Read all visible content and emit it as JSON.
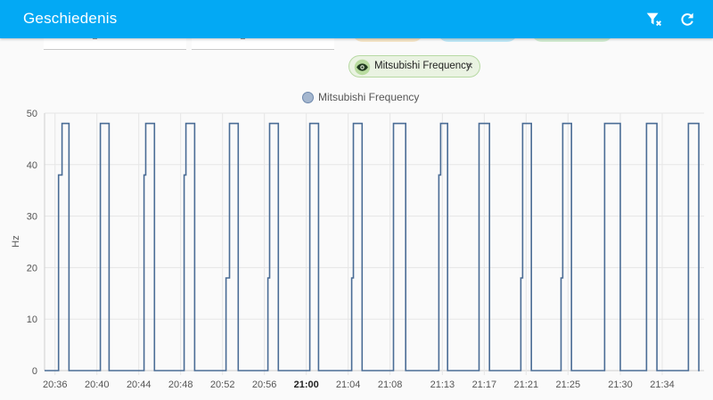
{
  "app": {
    "title": "Geschiedenis"
  },
  "toolbar": {
    "filter_icon": "filter-remove-icon",
    "refresh_icon": "refresh-icon"
  },
  "chip": {
    "label": "Mitsubishi Frequency",
    "close": "×",
    "icon": "eye-icon",
    "bg": "#eaf3e2"
  },
  "chart_data": {
    "type": "line",
    "step": true,
    "legend": "top-center",
    "ylabel": "Hz",
    "ylim": [
      0,
      50
    ],
    "yticks": [
      0,
      10,
      20,
      30,
      40,
      50
    ],
    "grid": true,
    "color": "#4a6c95",
    "xrange": [
      "20:35",
      "21:38"
    ],
    "xticks": [
      "20:36",
      "20:40",
      "20:44",
      "20:48",
      "20:52",
      "20:56",
      "21:00",
      "21:04",
      "21:08",
      "21:13",
      "21:17",
      "21:21",
      "21:25",
      "21:30",
      "21:34"
    ],
    "xticks_bold": [
      "21:00"
    ],
    "series": [
      {
        "name": "Mitsubishi Frequency",
        "points": [
          [
            "20:36:20",
            38
          ],
          [
            "20:36:40",
            48
          ],
          [
            "20:37:20",
            0
          ],
          [
            "20:40:20",
            48
          ],
          [
            "20:41:10",
            0
          ],
          [
            "20:44:30",
            38
          ],
          [
            "20:44:40",
            48
          ],
          [
            "20:45:30",
            0
          ],
          [
            "20:48:20",
            38
          ],
          [
            "20:48:30",
            48
          ],
          [
            "20:49:20",
            0
          ],
          [
            "20:52:20",
            18
          ],
          [
            "20:52:40",
            48
          ],
          [
            "20:53:30",
            0
          ],
          [
            "20:56:20",
            18
          ],
          [
            "20:56:30",
            48
          ],
          [
            "20:57:20",
            0
          ],
          [
            "21:00:20",
            48
          ],
          [
            "21:01:10",
            0
          ],
          [
            "21:04:20",
            18
          ],
          [
            "21:04:30",
            48
          ],
          [
            "21:05:20",
            0
          ],
          [
            "21:08:20",
            48
          ],
          [
            "21:09:30",
            0
          ],
          [
            "21:12:40",
            38
          ],
          [
            "21:12:50",
            48
          ],
          [
            "21:13:30",
            0
          ],
          [
            "21:16:30",
            48
          ],
          [
            "21:17:30",
            0
          ],
          [
            "21:20:30",
            18
          ],
          [
            "21:20:40",
            48
          ],
          [
            "21:21:30",
            0
          ],
          [
            "21:24:20",
            18
          ],
          [
            "21:24:30",
            48
          ],
          [
            "21:25:20",
            0
          ],
          [
            "21:28:30",
            48
          ],
          [
            "21:30:00",
            0
          ],
          [
            "21:32:30",
            48
          ],
          [
            "21:33:30",
            0
          ],
          [
            "21:36:30",
            48
          ],
          [
            "21:37:30",
            0
          ]
        ]
      }
    ]
  }
}
